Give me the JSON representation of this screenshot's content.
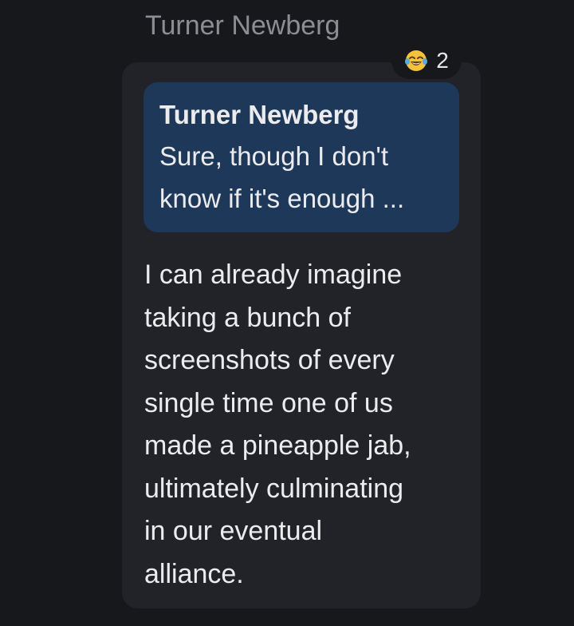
{
  "message": {
    "sender_name": "Turner Newberg",
    "reaction": {
      "emoji_icon": "tears-of-joy-emoji-icon",
      "count": "2"
    },
    "quote": {
      "author": "Turner Newberg",
      "lines": [
        "Sure, though I don't",
        "know if it's enough ..."
      ]
    },
    "body_lines": [
      "I can already imagine",
      "taking a bunch of",
      "screenshots of every",
      "single time one of us",
      "made a pineapple jab,",
      "ultimately culminating",
      "in our eventual",
      "alliance."
    ]
  },
  "colors": {
    "background": "#17181c",
    "bubble": "#222329",
    "quote_background": "#1e3859",
    "text": "#ececef",
    "sender_name": "#8c8e94"
  }
}
